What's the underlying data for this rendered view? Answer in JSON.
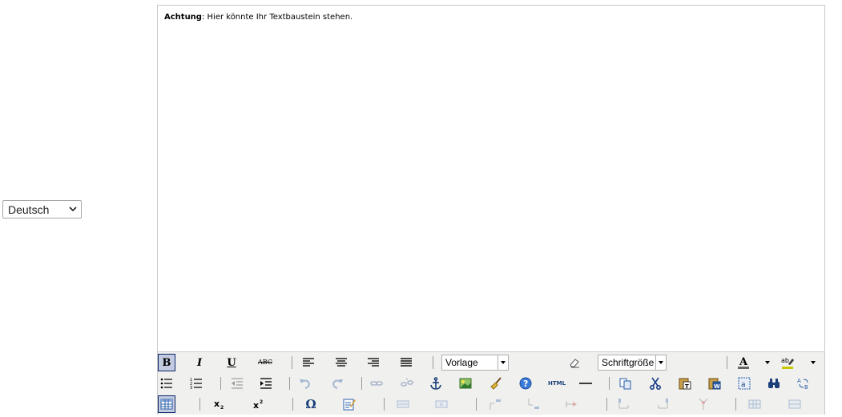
{
  "language_select": {
    "value": "Deutsch"
  },
  "editor": {
    "content": {
      "bold_text": "Achtung",
      "rest_text": ": Hier könnte Ihr Textbaustein stehen."
    },
    "toolbar": {
      "row1": {
        "bold": "B",
        "italic": "I",
        "underline": "U",
        "strikethrough": "ABC",
        "style_dropdown": "Vorlage",
        "fontsize_dropdown": "Schriftgröße"
      },
      "row2": {
        "html_button": "HTML"
      },
      "row3": {
        "special_char": "Ω"
      }
    }
  }
}
